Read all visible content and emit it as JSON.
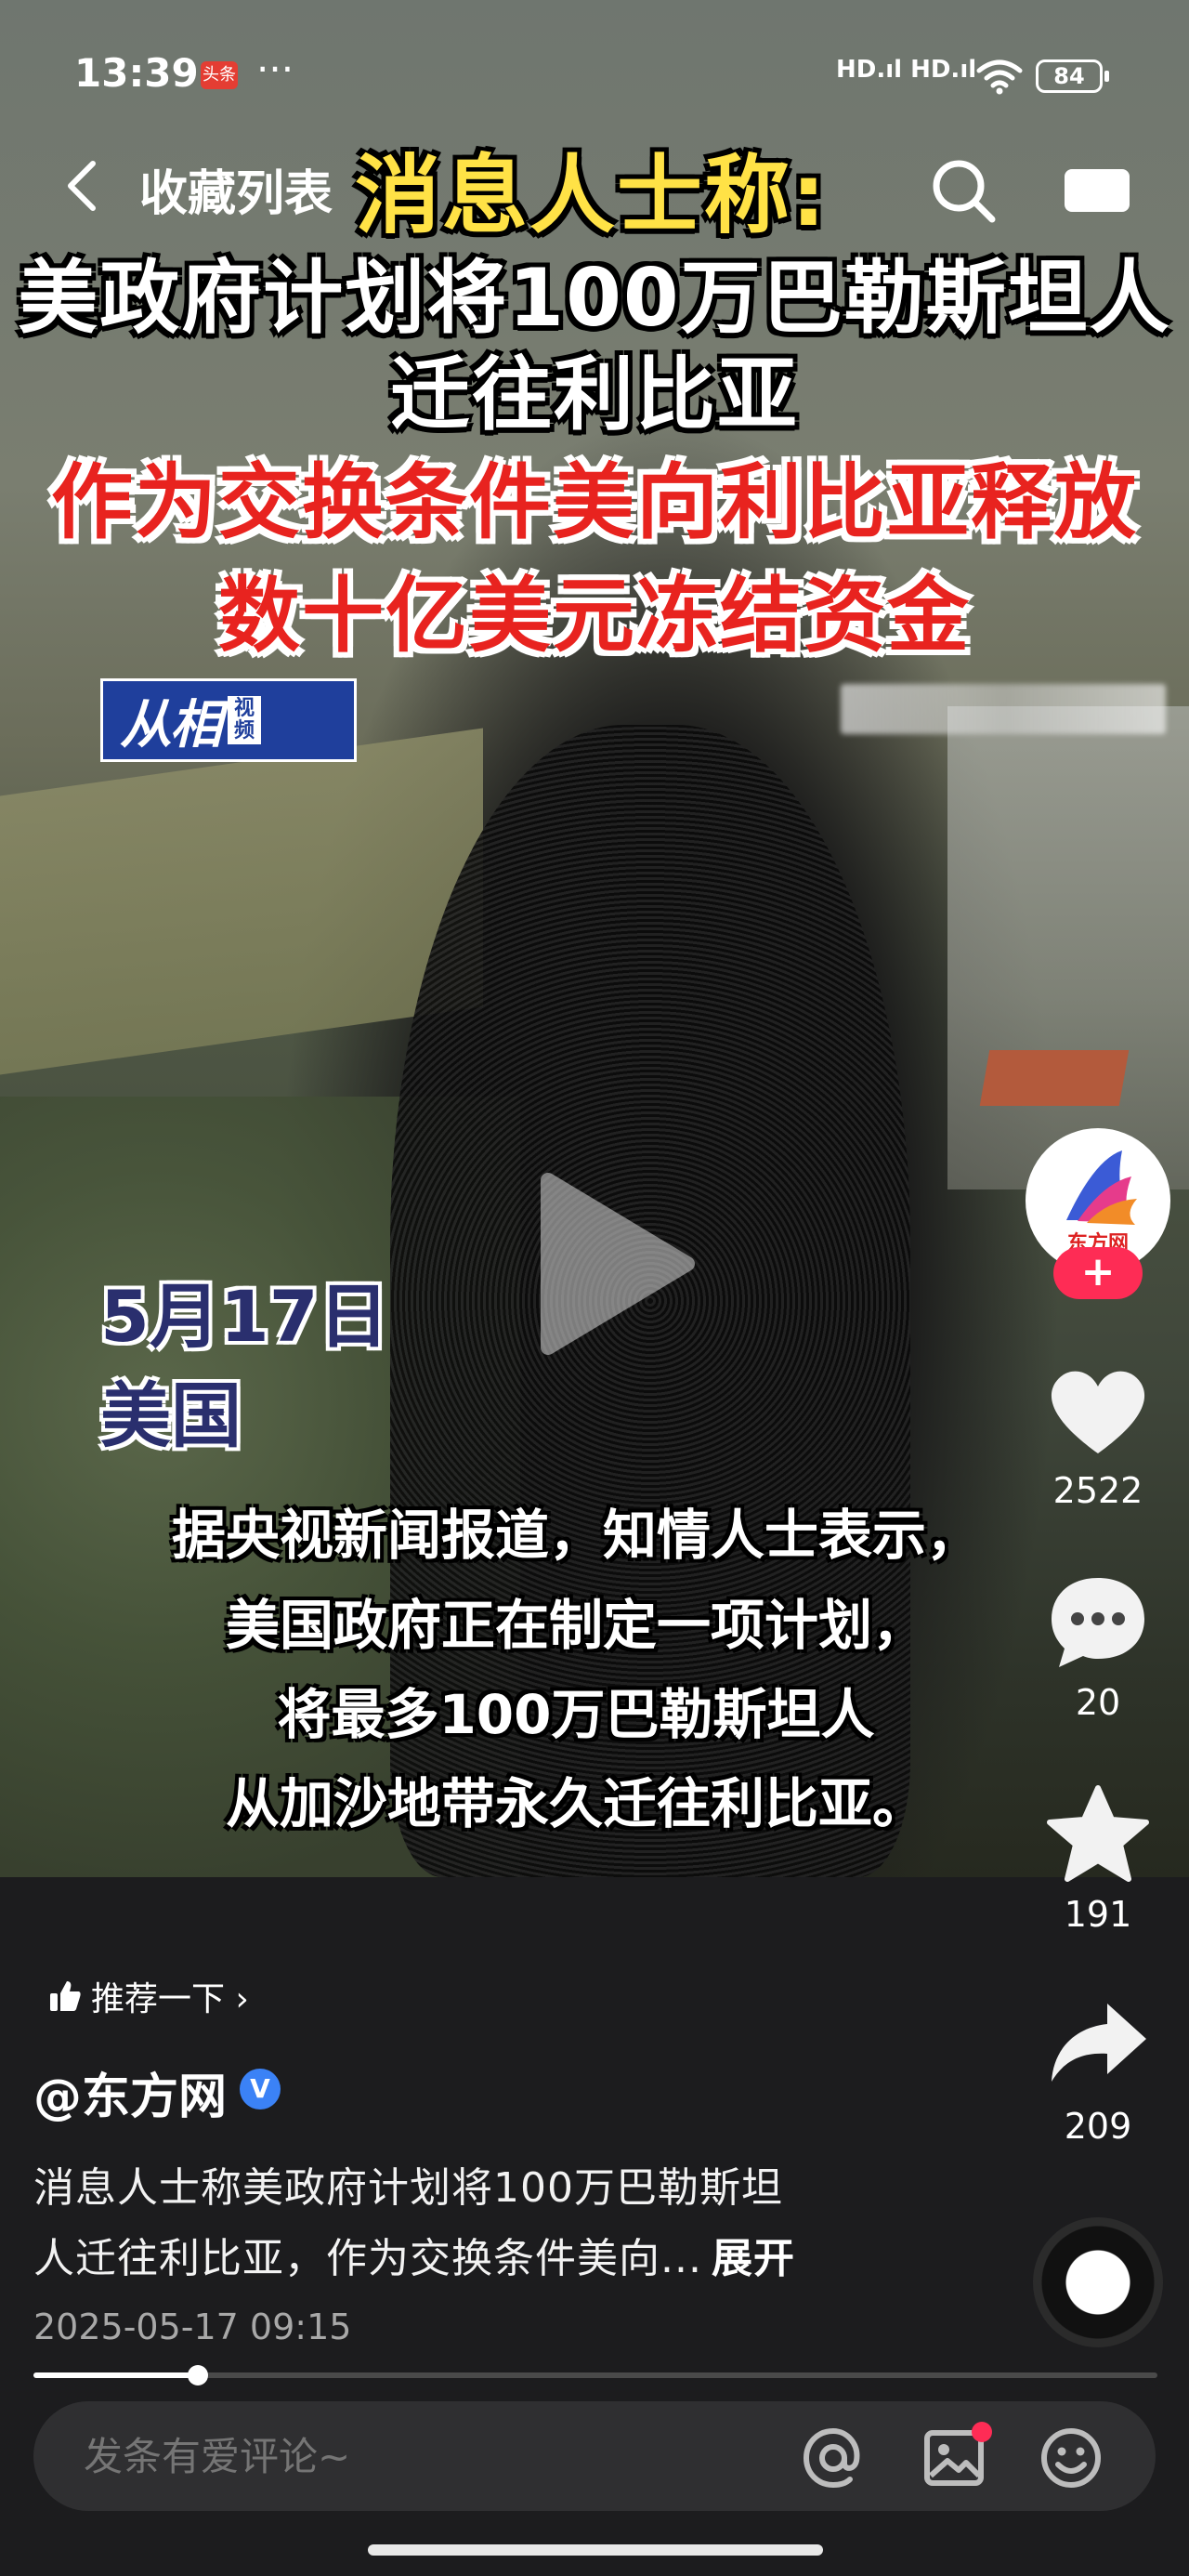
{
  "status_bar": {
    "time": "13:39",
    "app_badge": "头条",
    "more": "···",
    "signal": "HD.ıl HD.ıl",
    "battery": "84"
  },
  "nav": {
    "back_label": "收藏列表"
  },
  "video": {
    "headline_line1": "消息人士称:",
    "headline_line2": "美政府计划将100万巴勒斯坦人",
    "headline_line3": "迁往利比亚",
    "headline_line4": "作为交换条件美向利比亚释放",
    "headline_line5": "数十亿美元冻结资金",
    "source_logo_name": "从相",
    "source_logo_tag": "视频",
    "date": "5月17日",
    "location": "美国",
    "subtitles": [
      "据央视新闻报道，知情人士表示，",
      "美国政府正在制定一项计划，",
      "将最多100万巴勒斯坦人",
      "从加沙地带永久迁往利比亚。"
    ],
    "progress_fraction": 0.146
  },
  "author": {
    "avatar_text": "东方网",
    "name": "@东方网",
    "verified_mark": "V"
  },
  "actions": {
    "follow": "+",
    "like_count": "2522",
    "comment_count": "20",
    "favorite_count": "191",
    "share_count": "209"
  },
  "post": {
    "recommend_label": "推荐一下 ›",
    "description_line1": "消息人士称美政府计划将100万巴勒斯坦",
    "description_line2": "人迁往利比亚，作为交换条件美向...",
    "expand_label": "展开",
    "publish_time": "2025-05-17 09:15"
  },
  "comment_bar": {
    "placeholder": "发条有爱评论~"
  },
  "colors": {
    "headline_yellow": "#ffe246",
    "headline_red": "#e8231f",
    "accent_pink": "#fe2c55",
    "verified_blue": "#3b82f6"
  },
  "icons": [
    "back-icon",
    "search-icon",
    "cast-icon",
    "play-icon",
    "heart-icon",
    "comment-icon",
    "star-icon",
    "share-icon",
    "thumb-up-icon",
    "at-icon",
    "image-icon",
    "emoji-icon",
    "wifi-icon"
  ]
}
